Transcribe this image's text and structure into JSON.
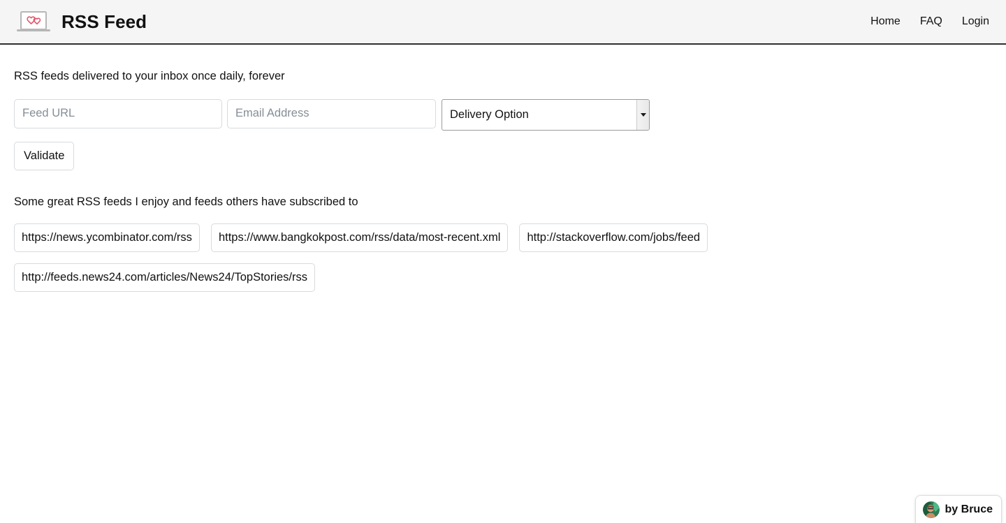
{
  "header": {
    "logo_icon": "laptop-hearts-logo-icon",
    "brand_title": "RSS Feed",
    "nav": [
      {
        "label": "Home",
        "name": "nav-link-home"
      },
      {
        "label": "FAQ",
        "name": "nav-link-faq"
      },
      {
        "label": "Login",
        "name": "nav-link-login"
      }
    ]
  },
  "main": {
    "tagline": "RSS feeds delivered to your inbox once daily, forever",
    "form": {
      "feed_url_placeholder": "Feed URL",
      "feed_url_value": "",
      "email_placeholder": "Email Address",
      "email_value": "",
      "delivery_select_value": "Delivery Option",
      "delivery_select_icon": "chevron-down-icon",
      "validate_label": "Validate"
    },
    "subhead": "Some great RSS feeds I enjoy and feeds others have subscribed to",
    "feeds": [
      "https://news.ycombinator.com/rss",
      "https://www.bangkokpost.com/rss/data/most-recent.xml",
      "http://stackoverflow.com/jobs/feed",
      "http://feeds.news24.com/articles/News24/TopStories/rss"
    ]
  },
  "footer_badge": {
    "label": "by Bruce",
    "avatar_icon": "author-avatar"
  },
  "colors": {
    "header_bg": "#f5f5f5",
    "header_border": "#2f2f2f",
    "page_bg": "#ffffff",
    "text": "#111111",
    "placeholder": "#868e96",
    "field_border": "#d8dade",
    "select_border": "#9a9a9a",
    "logo_heart": "#e4566e",
    "logo_laptop": "#b7b7b7"
  }
}
